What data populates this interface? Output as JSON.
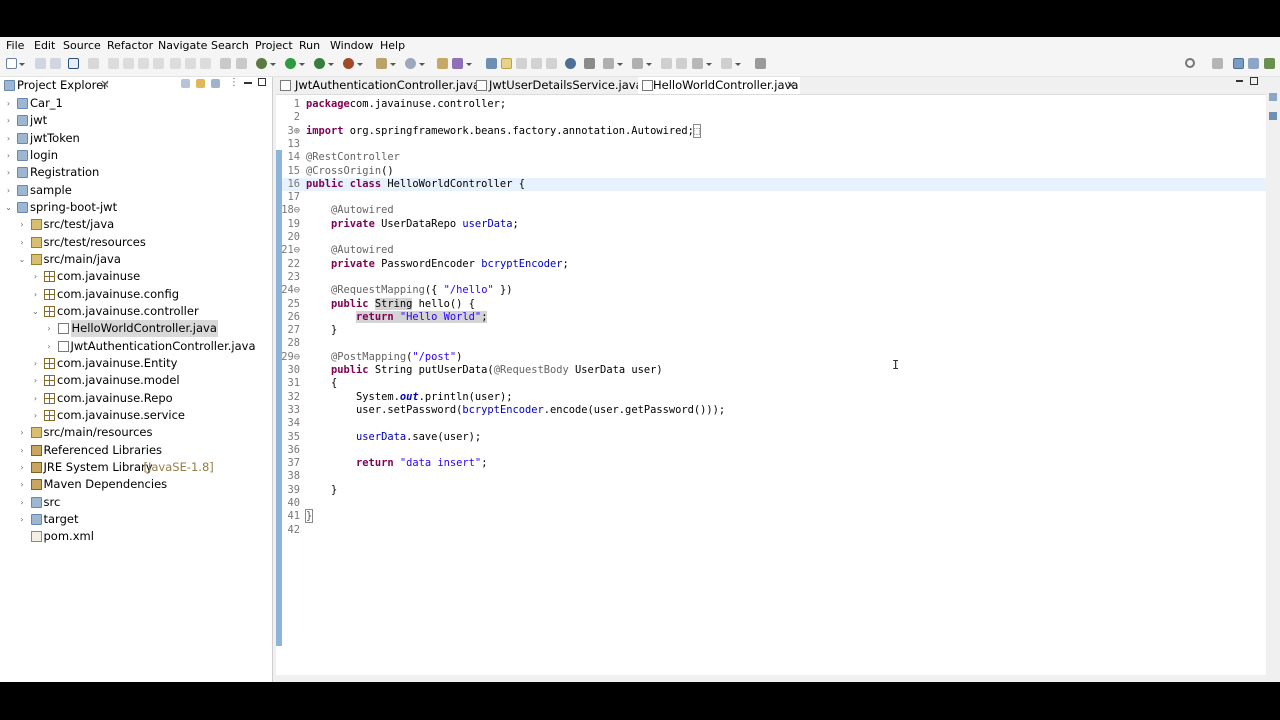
{
  "menubar": {
    "items": [
      "File",
      "Edit",
      "Source",
      "Refactor",
      "Navigate",
      "Search",
      "Project",
      "Run",
      "Window",
      "Help"
    ]
  },
  "explorer": {
    "title": "Project Explorer",
    "close_icon": "×",
    "tree": [
      {
        "label": "Car_1",
        "icon": "project-folder-icon",
        "depth": 0,
        "twisty": ">"
      },
      {
        "label": "jwt",
        "icon": "project-folder-icon",
        "depth": 0,
        "twisty": ">"
      },
      {
        "label": "jwtToken",
        "icon": "project-folder-icon",
        "depth": 0,
        "twisty": ">"
      },
      {
        "label": "login",
        "icon": "project-folder-icon",
        "depth": 0,
        "twisty": ">"
      },
      {
        "label": "Registration",
        "icon": "project-folder-icon",
        "depth": 0,
        "twisty": ">"
      },
      {
        "label": "sample",
        "icon": "project-folder-icon",
        "depth": 0,
        "twisty": ">"
      },
      {
        "label": "spring-boot-jwt",
        "icon": "project-folder-icon",
        "depth": 0,
        "twisty": "v"
      },
      {
        "label": "src/test/java",
        "icon": "source-folder-icon",
        "depth": 1,
        "twisty": ">"
      },
      {
        "label": "src/test/resources",
        "icon": "source-folder-icon",
        "depth": 1,
        "twisty": ">"
      },
      {
        "label": "src/main/java",
        "icon": "source-folder-icon",
        "depth": 1,
        "twisty": "v"
      },
      {
        "label": "com.javainuse",
        "icon": "package-icon",
        "depth": 2,
        "twisty": ">"
      },
      {
        "label": "com.javainuse.config",
        "icon": "package-icon",
        "depth": 2,
        "twisty": ">"
      },
      {
        "label": "com.javainuse.controller",
        "icon": "package-icon",
        "depth": 2,
        "twisty": "v"
      },
      {
        "label": "HelloWorldController.java",
        "icon": "java-file-icon",
        "depth": 3,
        "twisty": ">",
        "selected": true
      },
      {
        "label": "JwtAuthenticationController.java",
        "icon": "java-file-icon",
        "depth": 3,
        "twisty": ">"
      },
      {
        "label": "com.javainuse.Entity",
        "icon": "package-icon",
        "depth": 2,
        "twisty": ">"
      },
      {
        "label": "com.javainuse.model",
        "icon": "package-icon",
        "depth": 2,
        "twisty": ">"
      },
      {
        "label": "com.javainuse.Repo",
        "icon": "package-icon",
        "depth": 2,
        "twisty": ">"
      },
      {
        "label": "com.javainuse.service",
        "icon": "package-icon",
        "depth": 2,
        "twisty": ">"
      },
      {
        "label": "src/main/resources",
        "icon": "source-folder-icon",
        "depth": 1,
        "twisty": ">"
      },
      {
        "label": "Referenced Libraries",
        "icon": "library-icon",
        "depth": 1,
        "twisty": ">"
      },
      {
        "label": "JRE System Library",
        "suffix": "[JavaSE-1.8]",
        "icon": "library-icon",
        "depth": 1,
        "twisty": ">"
      },
      {
        "label": "Maven Dependencies",
        "icon": "library-icon",
        "depth": 1,
        "twisty": ">"
      },
      {
        "label": "src",
        "icon": "folder-icon",
        "depth": 1,
        "twisty": ">"
      },
      {
        "label": "target",
        "icon": "folder-icon",
        "depth": 1,
        "twisty": ">"
      },
      {
        "label": "pom.xml",
        "icon": "xml-file-icon",
        "depth": 1,
        "twisty": ""
      }
    ]
  },
  "editor": {
    "tabs": [
      {
        "label": "JwtAuthenticationController.java",
        "active": false
      },
      {
        "label": "JwtUserDetailsService.java",
        "active": false
      },
      {
        "label": "HelloWorldController.java",
        "active": true,
        "close": "×"
      }
    ],
    "lines": [
      {
        "n": "1",
        "code": [
          [
            "kw",
            "package"
          ],
          [
            "",
            "com.javainuse.controller;"
          ]
        ]
      },
      {
        "n": "2",
        "code": []
      },
      {
        "n": "3⊕",
        "code": [
          [
            "kw",
            "import"
          ],
          [
            "",
            " org.springframework.beans.factory.annotation.Autowired;"
          ],
          [
            "box",
            "⬚"
          ]
        ]
      },
      {
        "n": "13",
        "code": []
      },
      {
        "n": "14",
        "code": [
          [
            "ann",
            "@RestController"
          ]
        ]
      },
      {
        "n": "15",
        "code": [
          [
            "ann",
            "@CrossOrigin"
          ],
          [
            "",
            "()"
          ]
        ]
      },
      {
        "n": "16",
        "code": [
          [
            "kw",
            "public class"
          ],
          [
            "",
            " HelloWorldController {"
          ]
        ],
        "current": true
      },
      {
        "n": "17",
        "code": []
      },
      {
        "n": "18⊖",
        "code": [
          [
            "",
            "    "
          ],
          [
            "ann",
            "@Autowired"
          ]
        ]
      },
      {
        "n": "19",
        "code": [
          [
            "",
            "    "
          ],
          [
            "kw",
            "private"
          ],
          [
            "",
            " UserDataRepo "
          ],
          [
            "fld",
            "userData"
          ],
          [
            "",
            ";"
          ]
        ]
      },
      {
        "n": "20",
        "code": []
      },
      {
        "n": "21⊖",
        "code": [
          [
            "",
            "    "
          ],
          [
            "ann",
            "@Autowired"
          ]
        ]
      },
      {
        "n": "22",
        "code": [
          [
            "",
            "    "
          ],
          [
            "kw",
            "private"
          ],
          [
            "",
            " PasswordEncoder "
          ],
          [
            "fld",
            "bcryptEncoder"
          ],
          [
            "",
            ";"
          ]
        ]
      },
      {
        "n": "23",
        "code": []
      },
      {
        "n": "24⊖",
        "code": [
          [
            "",
            "    "
          ],
          [
            "ann",
            "@RequestMapping"
          ],
          [
            "",
            "({ "
          ],
          [
            "str",
            "\"/hello\""
          ],
          [
            "",
            " })"
          ]
        ]
      },
      {
        "n": "25",
        "code": [
          [
            "",
            "    "
          ],
          [
            "kw",
            "public"
          ],
          [
            "",
            " "
          ],
          [
            "hl",
            "String"
          ],
          [
            "",
            " hello() {"
          ]
        ]
      },
      {
        "n": "26",
        "code": [
          [
            "",
            "        "
          ],
          [
            "kwhl",
            "return"
          ],
          [
            "hl",
            " "
          ],
          [
            "strhl",
            "\"Hello World\""
          ],
          [
            "hl",
            ";"
          ]
        ]
      },
      {
        "n": "27",
        "code": [
          [
            "",
            "    }"
          ]
        ]
      },
      {
        "n": "28",
        "code": []
      },
      {
        "n": "29⊖",
        "code": [
          [
            "",
            "    "
          ],
          [
            "ann",
            "@PostMapping"
          ],
          [
            "",
            "("
          ],
          [
            "str",
            "\"/post\""
          ],
          [
            "",
            ")"
          ]
        ]
      },
      {
        "n": "30",
        "code": [
          [
            "",
            "    "
          ],
          [
            "kw",
            "public"
          ],
          [
            "",
            " String putUserData("
          ],
          [
            "ann",
            "@RequestBody"
          ],
          [
            "",
            " UserData user)"
          ]
        ]
      },
      {
        "n": "31",
        "code": [
          [
            "",
            "    {"
          ]
        ]
      },
      {
        "n": "32",
        "code": [
          [
            "",
            "        System."
          ],
          [
            "sfld",
            "out"
          ],
          [
            "",
            ".println(user);"
          ]
        ]
      },
      {
        "n": "33",
        "code": [
          [
            "",
            "        user.setPassword("
          ],
          [
            "fld",
            "bcryptEncoder"
          ],
          [
            "",
            ".encode(user.getPassword()));"
          ]
        ]
      },
      {
        "n": "34",
        "code": []
      },
      {
        "n": "35",
        "code": [
          [
            "",
            "        "
          ],
          [
            "fld",
            "userData"
          ],
          [
            "",
            ".save(user);"
          ]
        ]
      },
      {
        "n": "36",
        "code": []
      },
      {
        "n": "37",
        "code": [
          [
            "",
            "        "
          ],
          [
            "kw",
            "return"
          ],
          [
            "",
            " "
          ],
          [
            "str",
            "\"data insert\""
          ],
          [
            "",
            ";"
          ]
        ]
      },
      {
        "n": "38",
        "code": []
      },
      {
        "n": "39",
        "code": [
          [
            "",
            "    }"
          ]
        ]
      },
      {
        "n": "40",
        "code": []
      },
      {
        "n": "41",
        "code": [
          [
            "box",
            "}"
          ]
        ]
      },
      {
        "n": "42",
        "code": []
      }
    ]
  },
  "colors": {
    "keyword": "#7f0055",
    "annotation": "#646464",
    "string": "#2a00ff",
    "field": "#0000c0",
    "selection": "#d4d4d4",
    "current_line": "#e8f2fe",
    "change_bar": "#8fb4d9"
  }
}
